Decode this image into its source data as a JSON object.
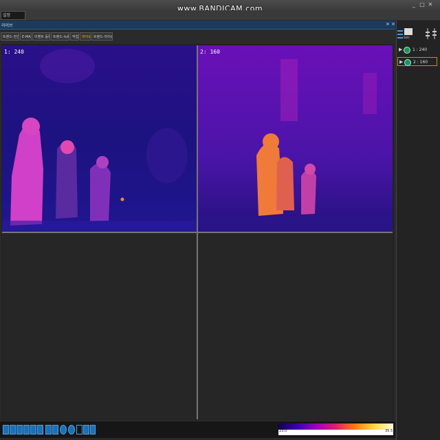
{
  "window": {
    "watermark": "www.BANDICAM.com",
    "buttons": [
      "_",
      "□",
      "✕"
    ]
  },
  "menu": {
    "item": "설정"
  },
  "panel": {
    "title": "라이브",
    "close_icon": "× ×"
  },
  "tabs": [
    {
      "label": "트렌드-전간",
      "active": false
    },
    {
      "label": "E-MAP",
      "active": false
    },
    {
      "label": "이벤트 등록",
      "active": false
    },
    {
      "label": "트렌드-녹화",
      "active": false
    },
    {
      "label": "작업",
      "active": false
    },
    {
      "label": "라이브",
      "active": true
    },
    {
      "label": "트렌드-라이브",
      "active": false
    }
  ],
  "video_grid": {
    "cells": [
      {
        "label": "1: 240",
        "palette": "ironbow",
        "content": "thermal"
      },
      {
        "label": "2: 160",
        "palette": "ironbow",
        "content": "thermal"
      },
      {
        "label": "",
        "content": "empty"
      },
      {
        "label": "",
        "content": "empty"
      }
    ]
  },
  "colorbar": {
    "min": "23.0",
    "max": "35.5"
  },
  "sidebar": {
    "toolbar_icons": [
      "list-icon",
      "select-camera-icon",
      "adjust-icon",
      "adjust-icon-2"
    ],
    "select_label": "Sele",
    "cameras": [
      {
        "label": "1 : 240",
        "selected": false
      },
      {
        "label": "2 : 160",
        "selected": true
      }
    ]
  },
  "bottom_toolbar": {
    "icons": [
      "layout-1x1-icon",
      "layout-2x2-icon",
      "layout-3x3-icon",
      "layout-4x4-icon",
      "layout-5x5-icon",
      "layout-6x6-icon",
      "prev-icon",
      "next-icon",
      "snapshot-icon",
      "settings-icon",
      "move-icon",
      "export-icon",
      "list-icon"
    ]
  },
  "colors": {
    "accent": "#1e6fb3",
    "selected": "#c88a2a",
    "panel_header": "#1b3a5c"
  }
}
